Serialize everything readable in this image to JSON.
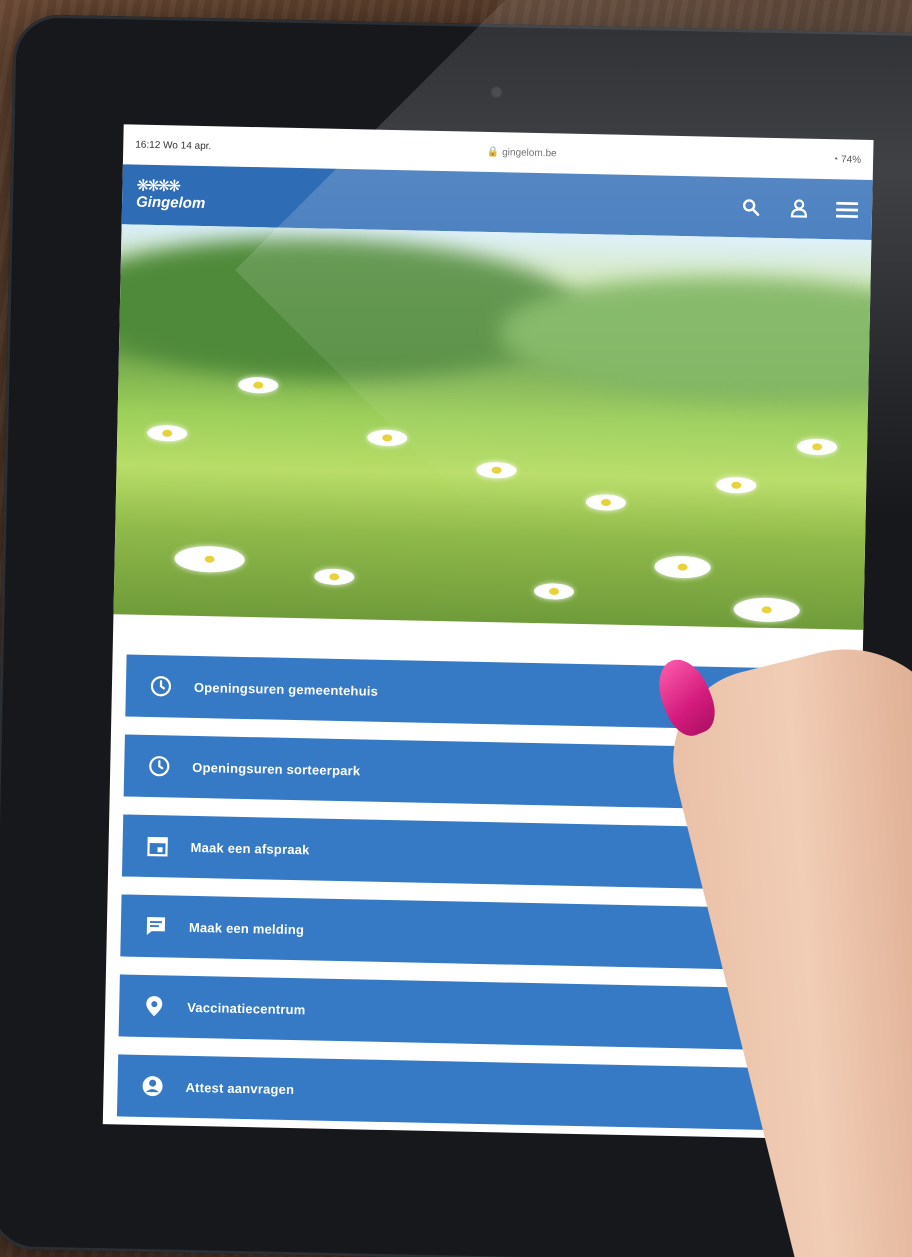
{
  "status_bar": {
    "time": "16:12",
    "date": "Wo 14 apr.",
    "url": "🔒 gingelom.be",
    "battery": "74%"
  },
  "header": {
    "logo_text": "Gingelom"
  },
  "menu": {
    "items": [
      {
        "icon": "clock-icon",
        "label": "Openingsuren gemeentehuis"
      },
      {
        "icon": "clock-icon",
        "label": "Openingsuren sorteerpark"
      },
      {
        "icon": "calendar-icon",
        "label": "Maak een afspraak"
      },
      {
        "icon": "chat-icon",
        "label": "Maak een melding"
      },
      {
        "icon": "location-pin-icon",
        "label": "Vaccinatiecentrum"
      },
      {
        "icon": "user-circle-icon",
        "label": "Attest aanvragen"
      }
    ]
  },
  "colors": {
    "brand_blue": "#2f6cb6",
    "button_blue": "#3679c4"
  }
}
